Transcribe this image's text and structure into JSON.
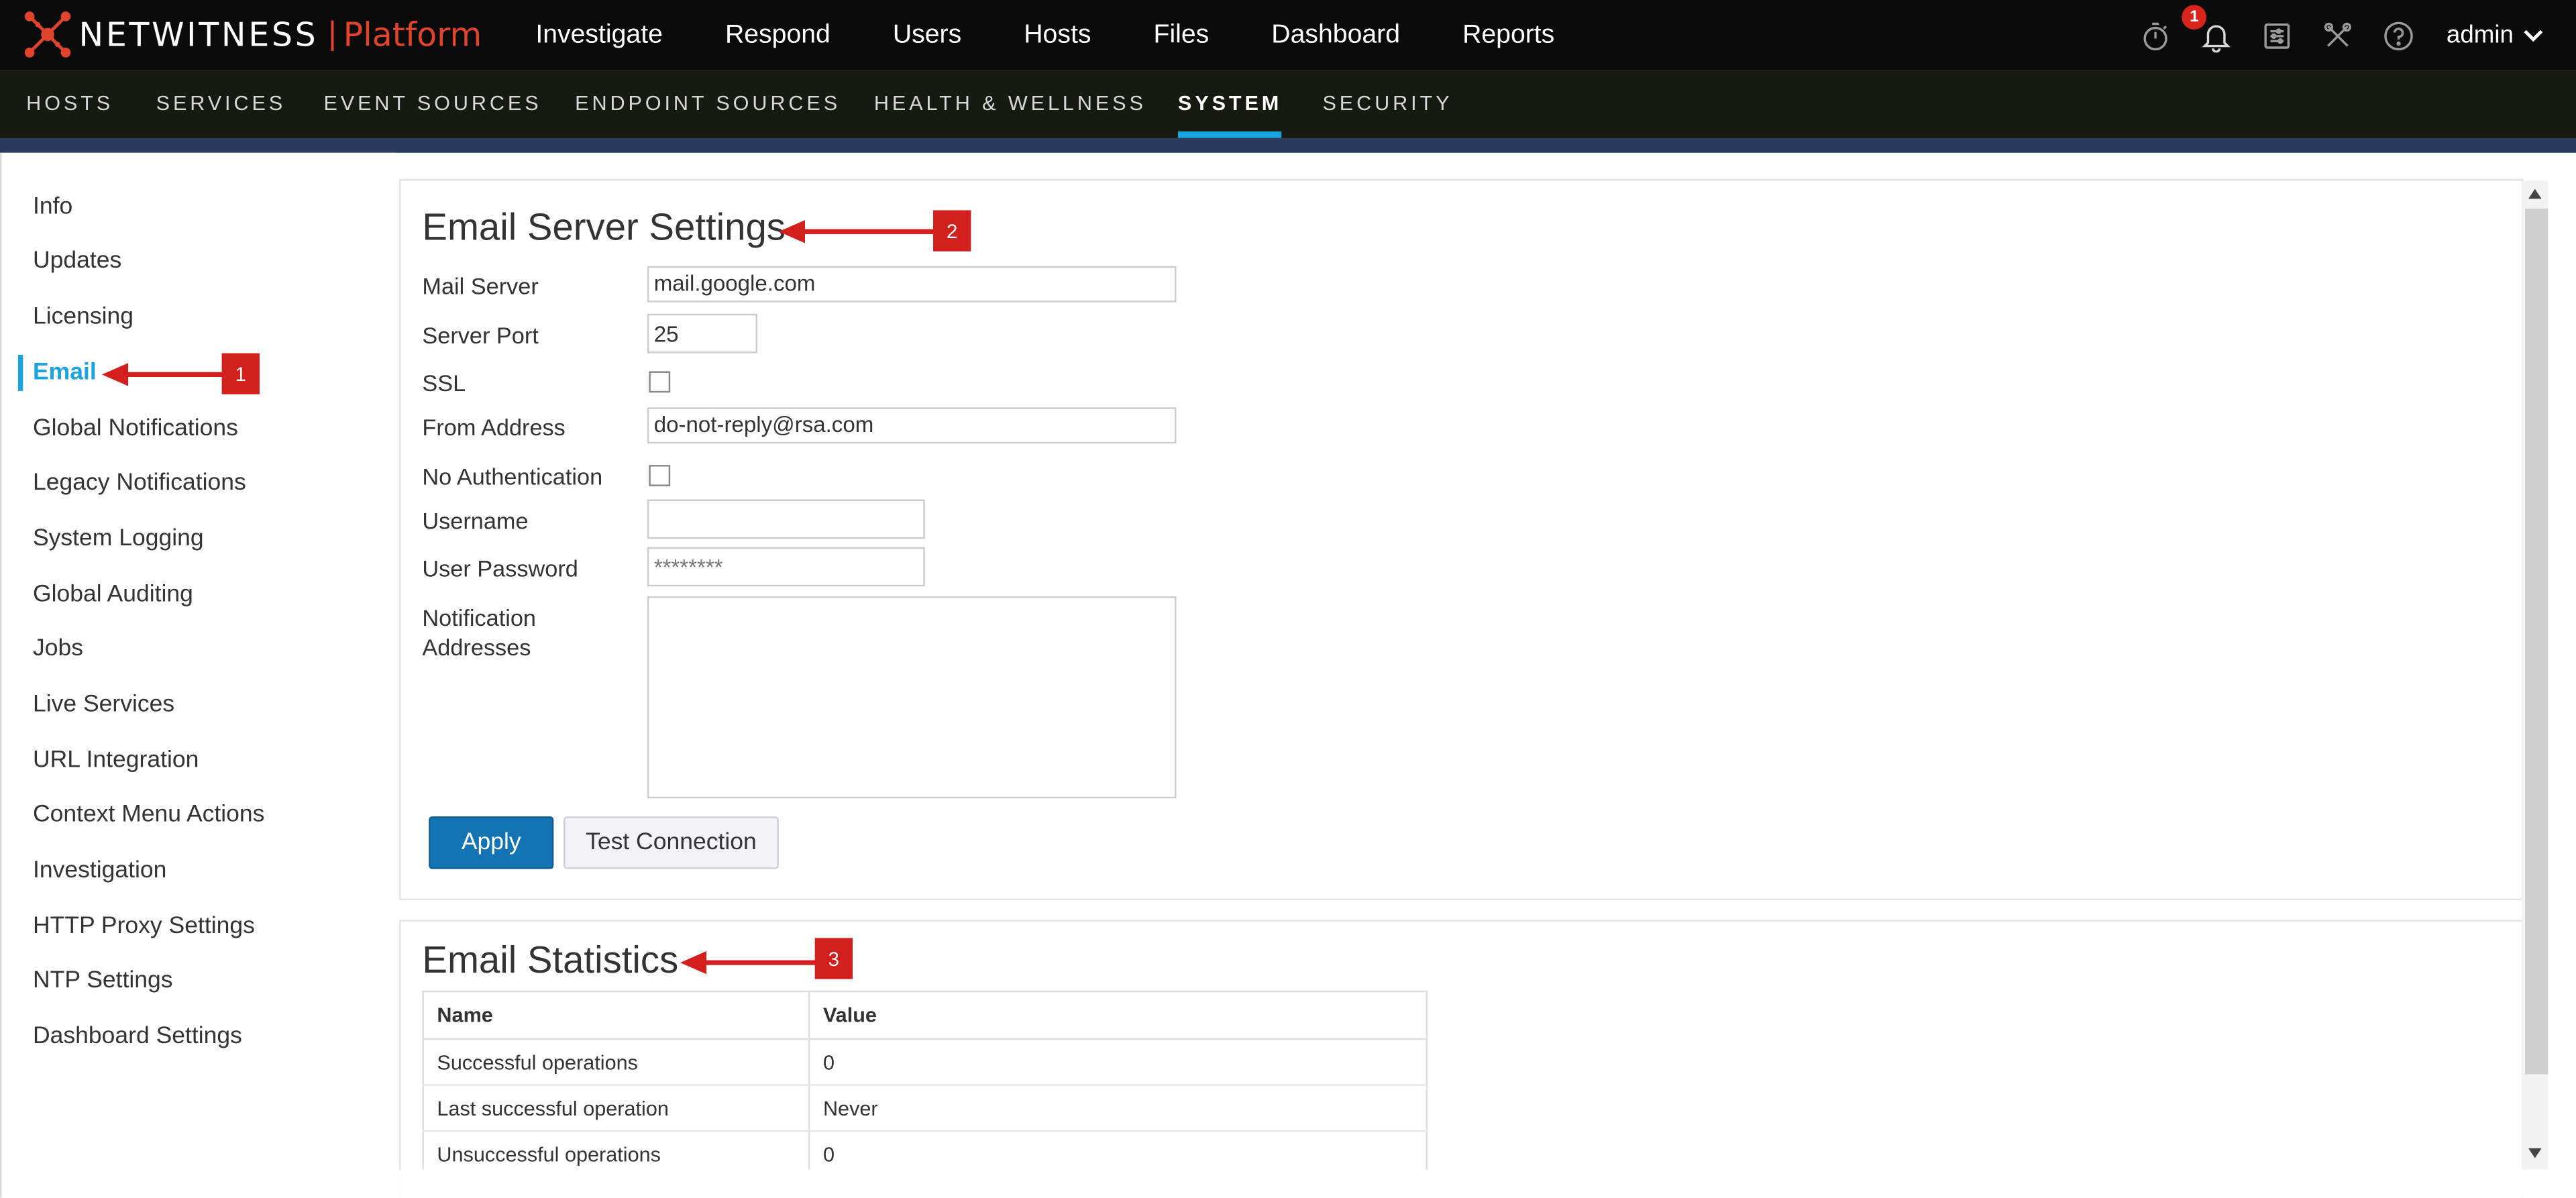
{
  "app": {
    "logo_text": "NETWITNESS",
    "logo_separator": "|",
    "logo_product": "Platform"
  },
  "topnav": {
    "items": [
      "Investigate",
      "Respond",
      "Users",
      "Hosts",
      "Files",
      "Dashboard",
      "Reports"
    ]
  },
  "topbar_icons": {
    "notification_count": "1",
    "user": "admin",
    "icons": [
      "stopwatch-icon",
      "bell-icon",
      "sliders-icon",
      "tools-icon",
      "help-icon",
      "chevron-down-icon"
    ]
  },
  "subnav": {
    "items": [
      "HOSTS",
      "SERVICES",
      "EVENT SOURCES",
      "ENDPOINT SOURCES",
      "HEALTH & WELLNESS",
      "SYSTEM",
      "SECURITY"
    ],
    "active": "SYSTEM"
  },
  "leftnav": {
    "items": [
      "Info",
      "Updates",
      "Licensing",
      "Email",
      "Global Notifications",
      "Legacy Notifications",
      "System Logging",
      "Global Auditing",
      "Jobs",
      "Live Services",
      "URL Integration",
      "Context Menu Actions",
      "Investigation",
      "HTTP Proxy Settings",
      "NTP Settings",
      "Dashboard Settings"
    ],
    "active": "Email"
  },
  "email_server": {
    "title": "Email Server Settings",
    "mail_server_label": "Mail Server",
    "mail_server_value": "mail.google.com",
    "server_port_label": "Server Port",
    "server_port_value": "25",
    "ssl_label": "SSL",
    "ssl_checked": false,
    "from_address_label": "From Address",
    "from_address_value": "do-not-reply@rsa.com",
    "no_auth_label": "No Authentication",
    "no_auth_checked": false,
    "username_label": "Username",
    "username_value": "",
    "password_label": "User Password",
    "password_value": "********",
    "notification_label_line1": "Notification",
    "notification_label_line2": "Addresses",
    "notification_value": "",
    "apply_label": "Apply",
    "test_label": "Test Connection"
  },
  "email_stats": {
    "title": "Email Statistics",
    "columns": [
      "Name",
      "Value"
    ],
    "rows": [
      [
        "Successful operations",
        "0"
      ],
      [
        "Last successful operation",
        "Never"
      ],
      [
        "Unsuccessful operations",
        "0"
      ]
    ]
  },
  "callouts": [
    "1",
    "2",
    "3"
  ],
  "colors": {
    "accent": "#19a3e0",
    "primary_button": "#1473b3",
    "callout": "#d41f1f",
    "brand_orange": "#e0442c",
    "topbar": "#0b0b0b"
  }
}
